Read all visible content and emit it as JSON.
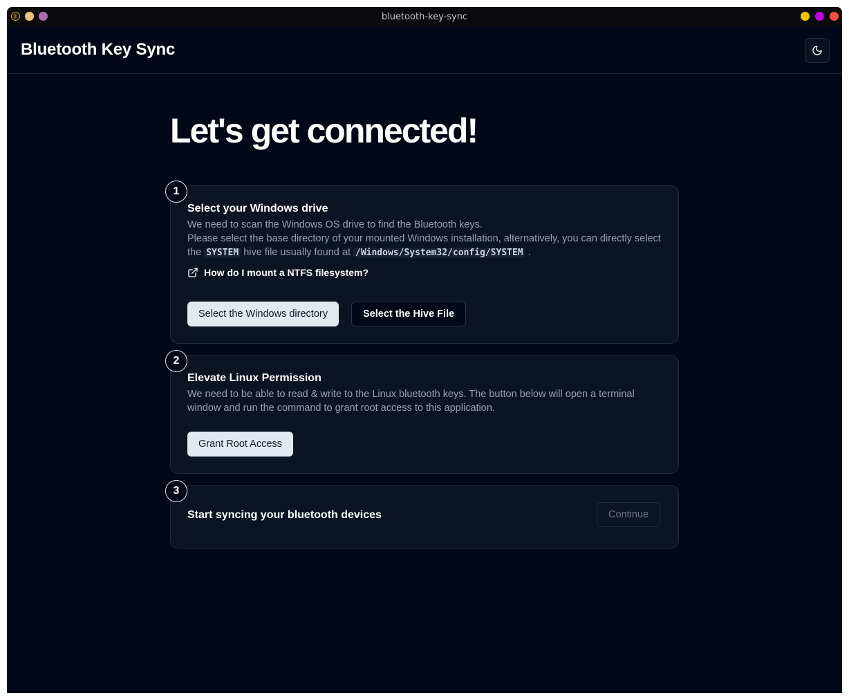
{
  "window": {
    "title": "bluetooth-key-sync",
    "left_dots": [
      "#f0c27b",
      "#b06ab3"
    ],
    "right_dots": [
      "#f5c400",
      "#c000e0",
      "#ff4f3a"
    ]
  },
  "header": {
    "app_title": "Bluetooth Key Sync",
    "theme_toggle_icon": "moon-icon"
  },
  "hero": {
    "heading": "Let's get connected!"
  },
  "steps": [
    {
      "number": "1",
      "title": "Select your Windows drive",
      "desc_line1": "We need to scan the Windows OS drive to find the Bluetooth keys.",
      "desc_line2_part1": "Please select the base directory of your mounted Windows installation, alternatively, you can directly select the",
      "desc_code1": "SYSTEM",
      "desc_line2_part2": "hive file usually found at",
      "desc_code2": "/Windows/System32/config/SYSTEM",
      "desc_end": ".",
      "help_link": "How do I mount a NTFS filesystem?",
      "help_icon": "external-link-icon",
      "primary_button": "Select the Windows directory",
      "secondary_button": "Select the Hive File"
    },
    {
      "number": "2",
      "title": "Elevate Linux Permission",
      "description": "We need to be able to read & write to the Linux bluetooth keys. The button below will open a terminal window and run the command to grant root access to this application.",
      "button": "Grant Root Access"
    },
    {
      "number": "3",
      "title": "Start syncing your bluetooth devices",
      "button": "Continue",
      "button_state": "disabled"
    }
  ]
}
